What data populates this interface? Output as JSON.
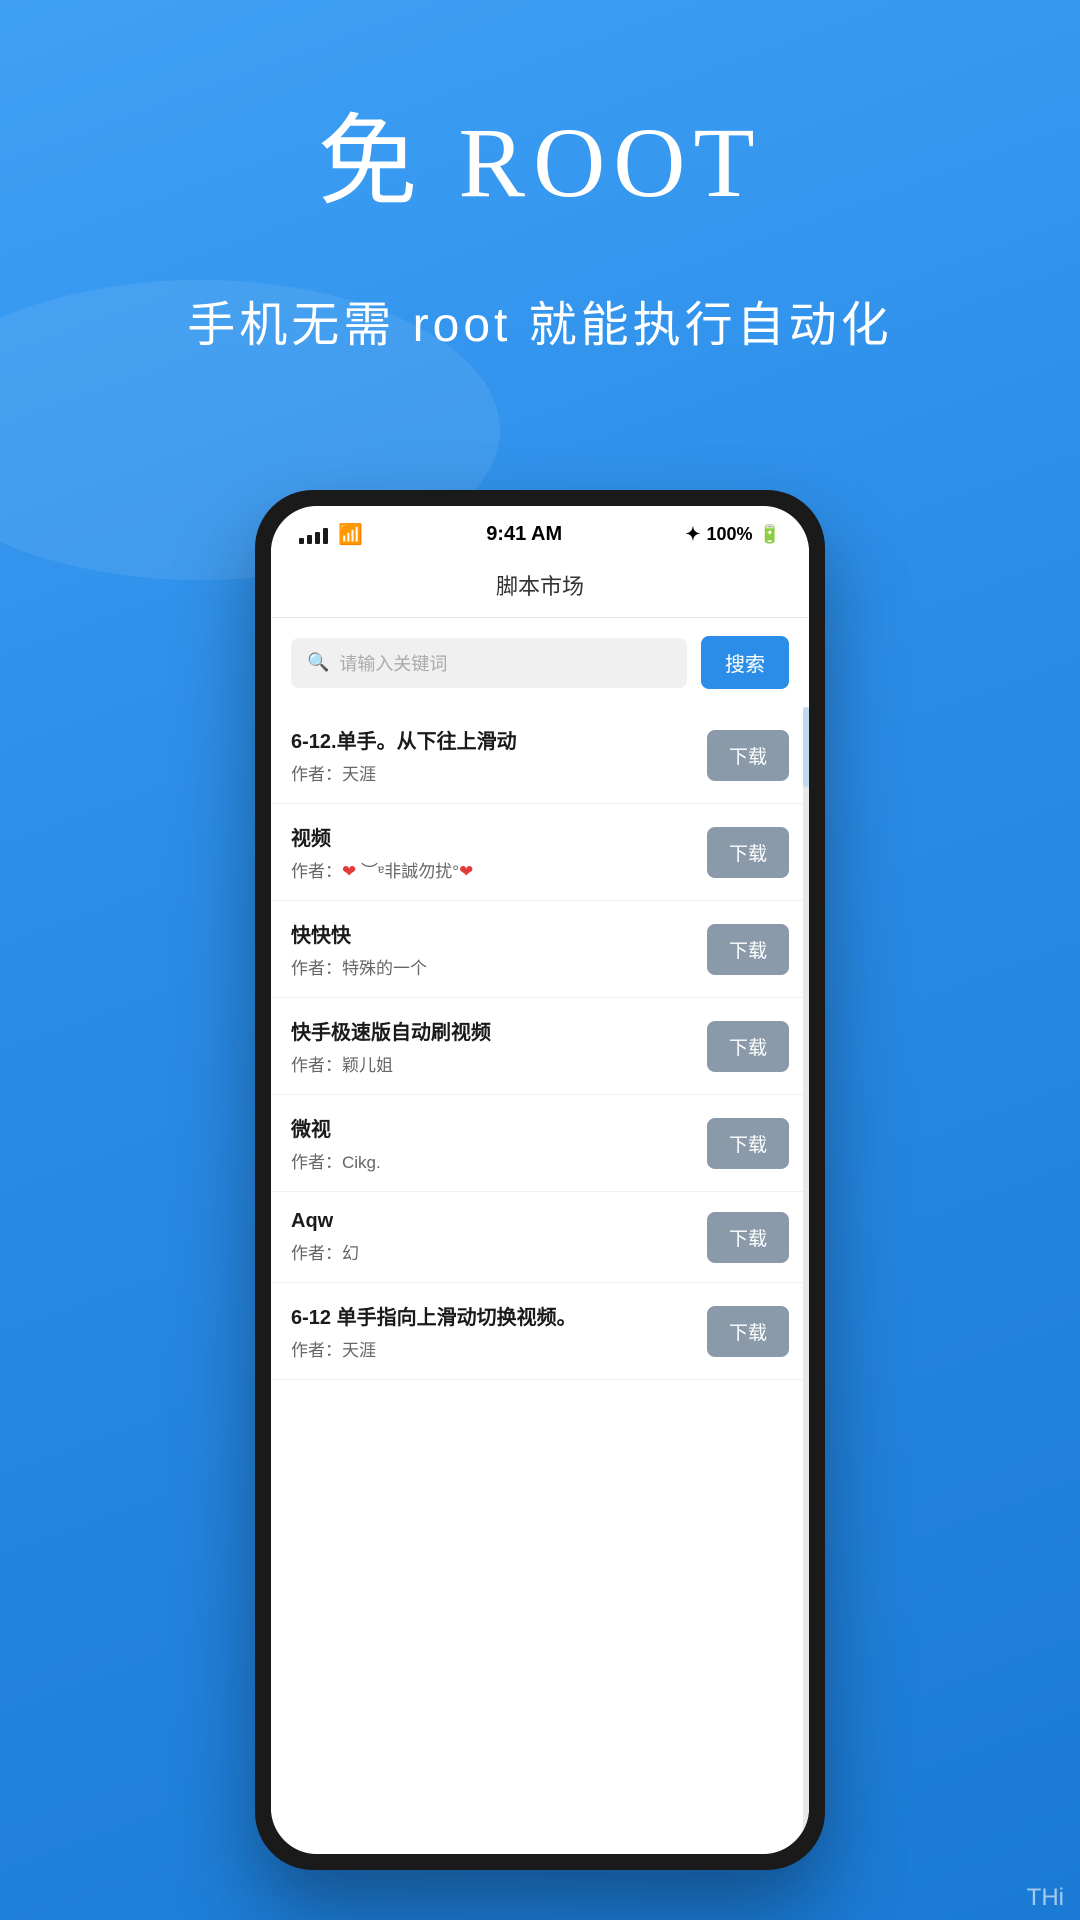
{
  "hero": {
    "title": "免 ROOT",
    "subtitle": "手机无需 root 就能执行自动化"
  },
  "phone": {
    "status_bar": {
      "time": "9:41 AM",
      "battery": "100%",
      "bluetooth": "✦"
    },
    "app_title": "脚本市场",
    "search": {
      "placeholder": "请输入关键词",
      "button_label": "搜索"
    },
    "scripts": [
      {
        "name": "6-12.单手。从下往上滑动",
        "author": "作者：天涯",
        "download_label": "下载"
      },
      {
        "name": "视频",
        "author_prefix": "作者：",
        "author_special": true,
        "author_text": "❤️ ︶ᵄ非誠勿扰°❤️",
        "download_label": "下载"
      },
      {
        "name": "快快快",
        "author": "作者：特殊的一个",
        "download_label": "下载"
      },
      {
        "name": "快手极速版自动刷视频",
        "author": "作者：颖儿姐",
        "download_label": "下载"
      },
      {
        "name": "微视",
        "author": "作者：Cikg.",
        "download_label": "下载"
      },
      {
        "name": "Aqw",
        "author": "作者：幻",
        "download_label": "下载"
      },
      {
        "name": "6-12  单手指向上滑动切换视频。",
        "author": "作者：天涯",
        "download_label": "下载"
      }
    ]
  },
  "bottom_watermark": "THi"
}
